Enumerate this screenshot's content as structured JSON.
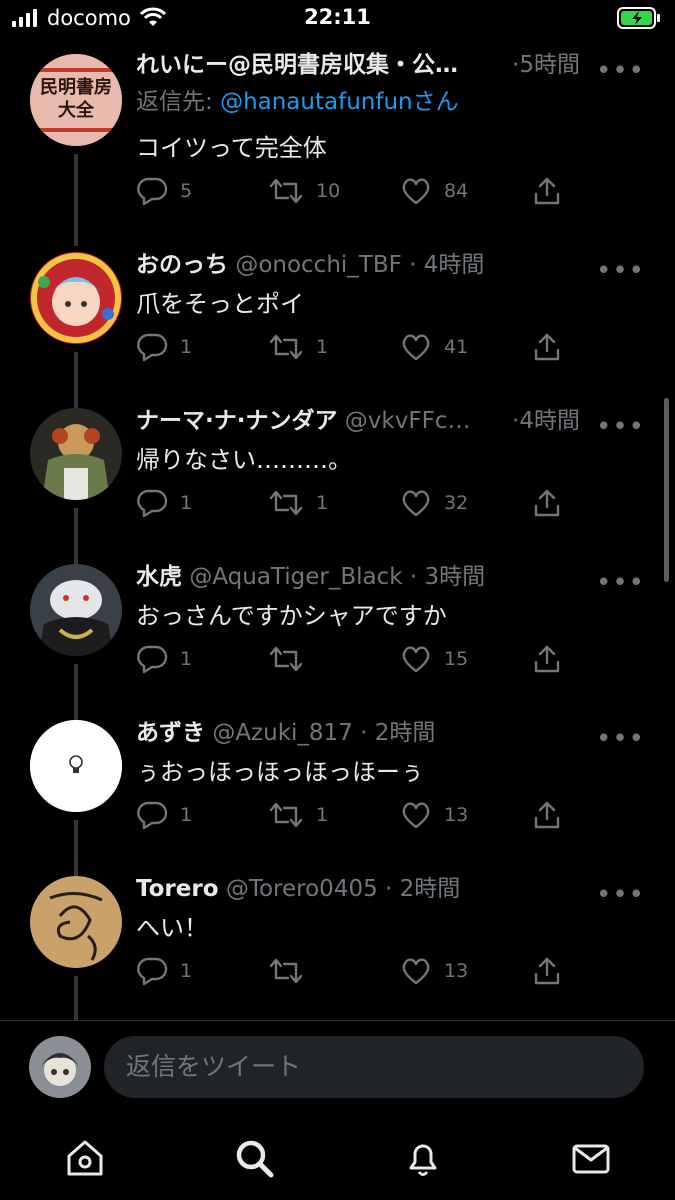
{
  "status_bar": {
    "carrier": "docomo",
    "time": "22:11"
  },
  "tweets": [
    {
      "name": "れいにー@民明書房収集・公…",
      "handle": "",
      "time": "5時間",
      "reply_prefix": "返信先: ",
      "reply_to": "@hanautafunfunさん",
      "text": "コイツって完全体",
      "replies": "5",
      "retweets": "10",
      "likes": "84",
      "avatar_text": "民明書房大全"
    },
    {
      "name": "おのっち",
      "handle": "@onocchi_TBF",
      "time": "4時間",
      "text": "爪をそっとポイ",
      "replies": "1",
      "retweets": "1",
      "likes": "41"
    },
    {
      "name": "ナーマ·ナ·ナンダア",
      "handle": "@vkvFFc…",
      "time": "4時間",
      "text": "帰りなさい………。",
      "replies": "1",
      "retweets": "1",
      "likes": "32"
    },
    {
      "name": "水虎",
      "handle": "@AquaTiger_Black",
      "time": "3時間",
      "text": "おっさんですかシャアですか",
      "replies": "1",
      "retweets": "",
      "likes": "15"
    },
    {
      "name": "あずき",
      "handle": "@Azuki_817",
      "time": "2時間",
      "text": "ぅおっほっほっほっほーぅ",
      "replies": "1",
      "retweets": "1",
      "likes": "13"
    },
    {
      "name": "Torero",
      "handle": "@Torero0405",
      "time": "2時間",
      "text": "へい！",
      "replies": "1",
      "retweets": "",
      "likes": "13"
    }
  ],
  "composer": {
    "placeholder": "返信をツイート"
  },
  "colors": {
    "accent": "#1d9bf0",
    "muted": "#71767b",
    "background": "#000000"
  }
}
